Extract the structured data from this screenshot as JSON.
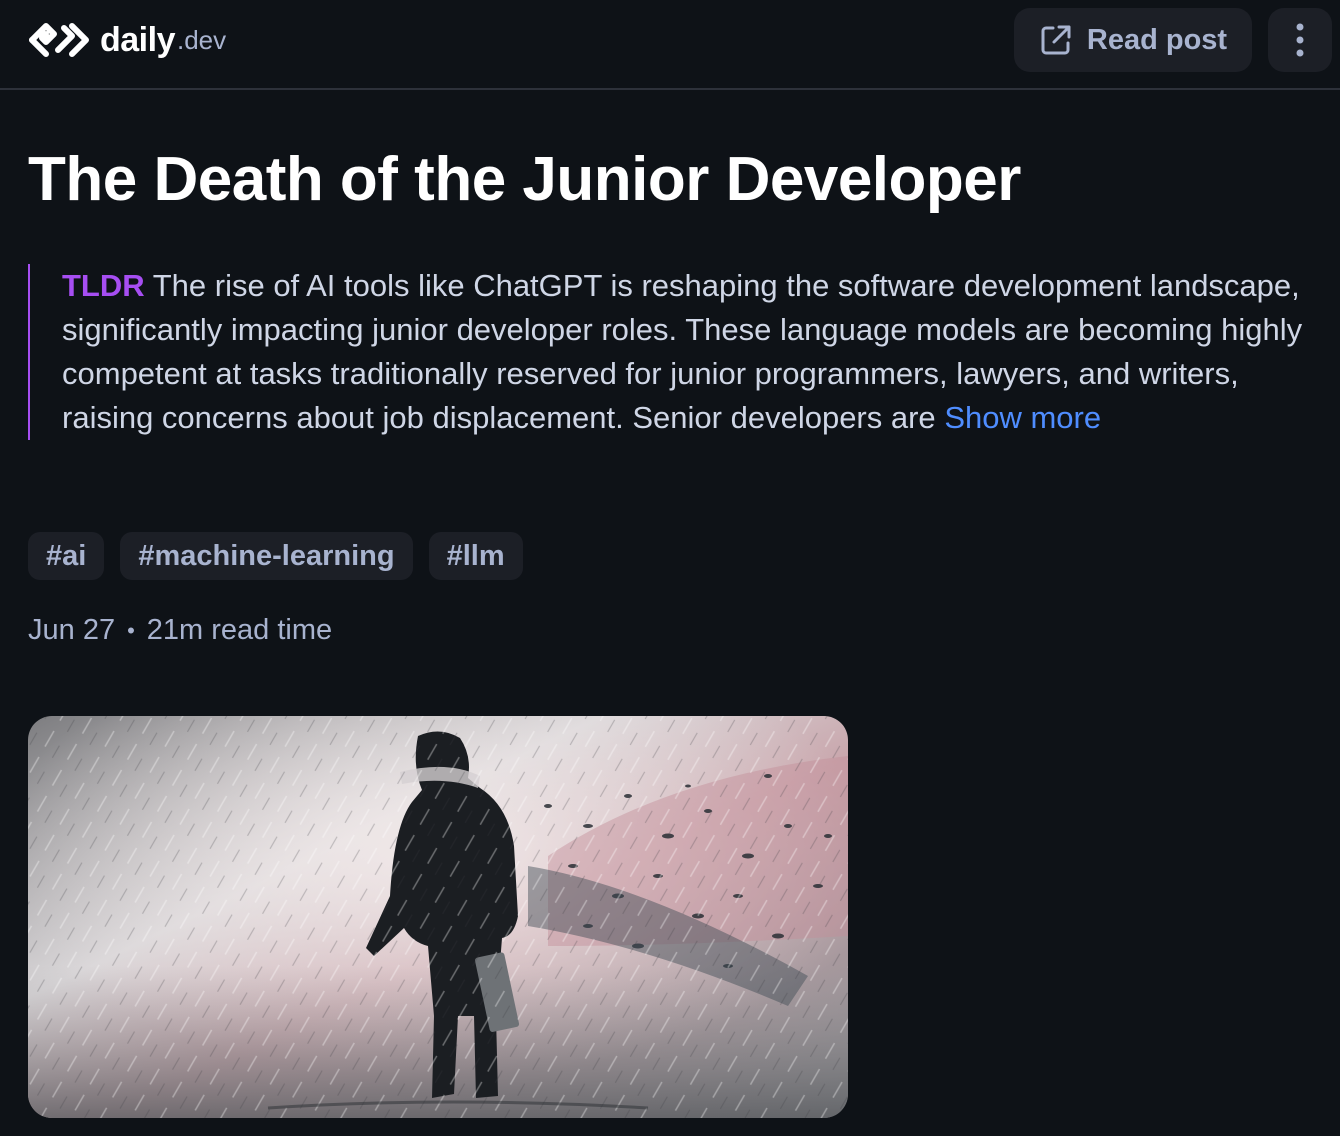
{
  "header": {
    "logo": {
      "word": "daily",
      "suffix": ".dev"
    },
    "read_post_label": "Read post",
    "read_post_icon": "external-link-icon",
    "menu_icon": "more-vertical-icon"
  },
  "post": {
    "title": "The Death of the Junior Developer",
    "tldr_label": "TLDR",
    "tldr_text": "The rise of AI tools like ChatGPT is reshaping the software development landscape, significantly impacting junior developer roles. These language models are becoming highly competent at tasks traditionally reserved for junior programmers, lawyers, and writers, raising concerns about job displacement. Senior developers are",
    "show_more_label": "Show more",
    "tags": [
      "#ai",
      "#machine-learning",
      "#llm"
    ],
    "date": "Jun 27",
    "separator": "•",
    "read_time": "21m read time"
  },
  "colors": {
    "background": "#0e1217",
    "accent_purple": "#a64ef2",
    "link_blue": "#4f8dff",
    "muted_text": "#a8b3cf",
    "chip_bg": "#1c1f26"
  }
}
